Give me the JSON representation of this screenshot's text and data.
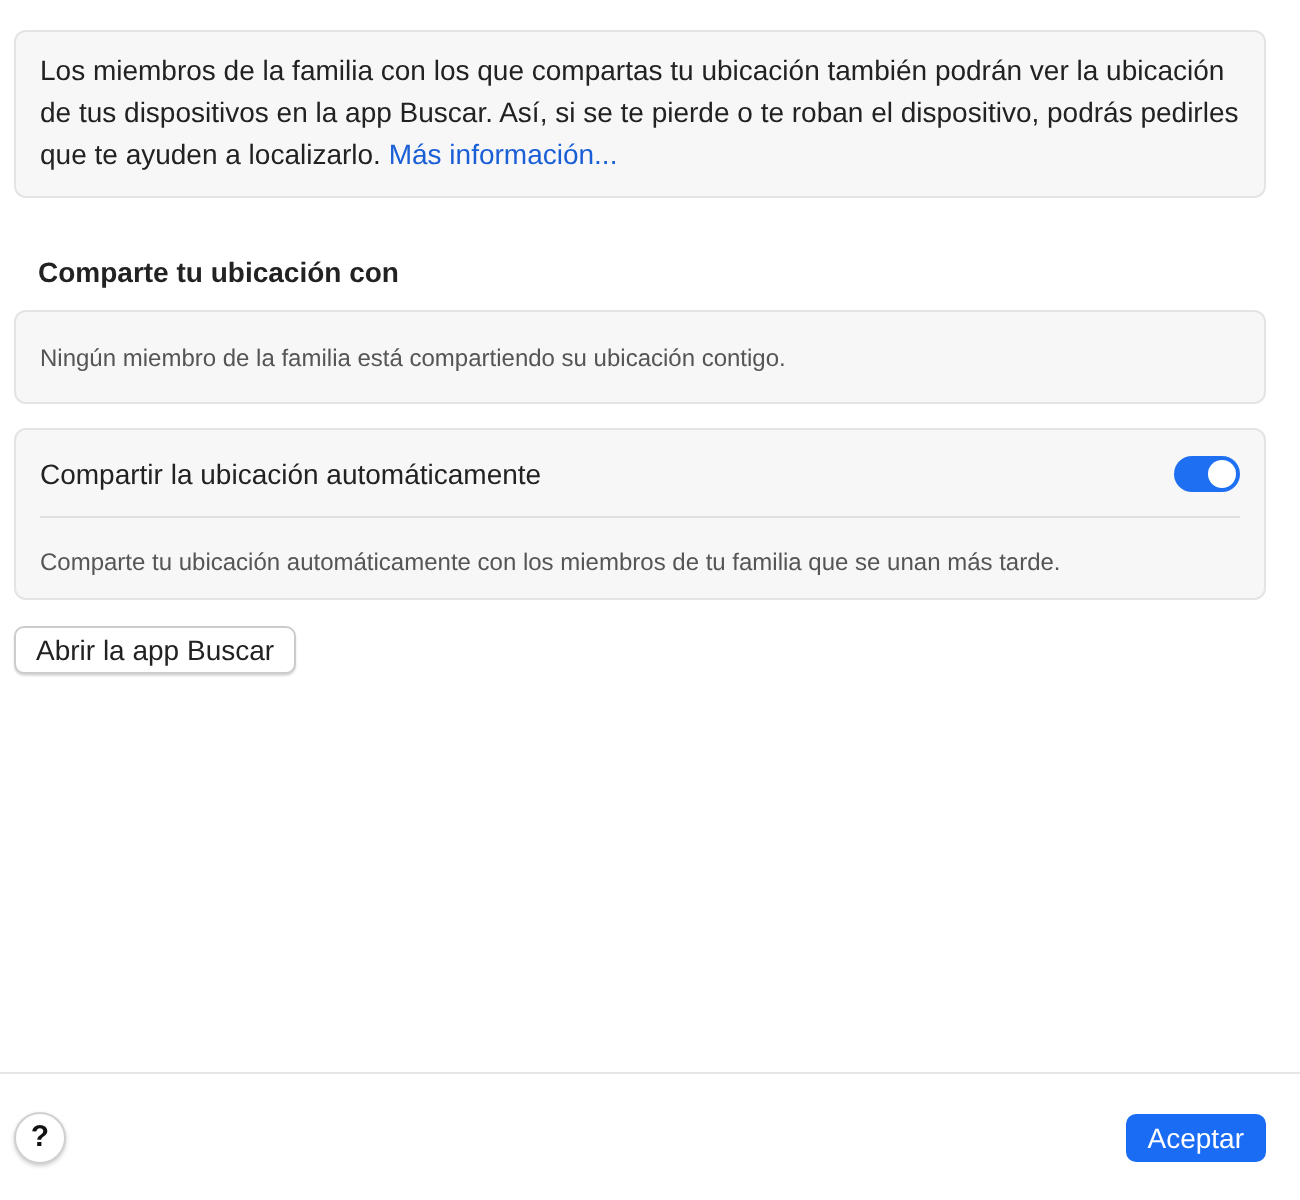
{
  "info": {
    "text": "Los miembros de la familia con los que compartas tu ubicación también podrán ver la ubicación de tus dispositivos en la app Buscar. Así, si se te pierde o te roban el dispositivo, podrás pedirles que te ayuden a localizarlo.",
    "link": "Más información..."
  },
  "section_title": "Comparte tu ubicación con",
  "sharing_status": "Ningún miembro de la familia está compartiendo su ubicación contigo.",
  "auto_share": {
    "label": "Compartir la ubicación automáticamente",
    "on": true,
    "description": "Comparte tu ubicación automáticamente con los miembros de tu familia que se unan más tarde."
  },
  "open_button": "Abrir la app Buscar",
  "help_button": "?",
  "ok_button": "Aceptar"
}
